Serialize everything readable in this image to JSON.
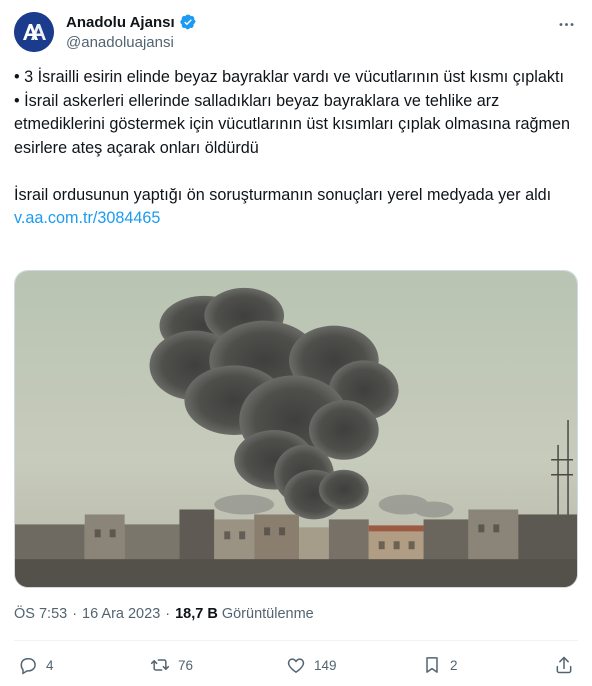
{
  "author": {
    "display_name": "Anadolu Ajansı",
    "handle": "@anadoluajansi",
    "avatar_icon": "aa-logo-icon",
    "verified_icon": "verified-badge-icon",
    "avatar_text": "AA",
    "colors": {
      "avatar_bg": "#1b3c8c",
      "verified": "#1d9bf0"
    }
  },
  "more_icon": "more-horizontal-icon",
  "tweet": {
    "line1": "• 3 İsrailli esirin elinde beyaz bayraklar vardı ve vücutlarının üst kısmı çıplaktı",
    "line2": "• İsrail askerleri ellerinde salladıkları beyaz bayraklara ve tehlike arz etmediklerini göstermek için vücutlarının üst kısımları çıplak olmasına rağmen esirlere ateş açarak onları öldürdü",
    "line3_text": "İsrail ordusunun yaptığı ön soruşturmanın sonuçları yerel medyada yer aldı ",
    "link": "v.aa.com.tr/3084465",
    "link_color": "#1d9bf0"
  },
  "media": {
    "kind": "photo",
    "description_icon": "photo-smoke-over-city"
  },
  "meta": {
    "time": "ÖS 7:53",
    "separator": "·",
    "date": "16 Ara 2023",
    "views_count": "18,7 B",
    "views_label": "Görüntülenme"
  },
  "actions": {
    "reply": {
      "icon": "reply-icon",
      "count": "4"
    },
    "retweet": {
      "icon": "retweet-icon",
      "count": "76"
    },
    "like": {
      "icon": "heart-icon",
      "count": "149"
    },
    "bookmark": {
      "icon": "bookmark-icon",
      "count": "2"
    },
    "share": {
      "icon": "share-icon"
    }
  }
}
